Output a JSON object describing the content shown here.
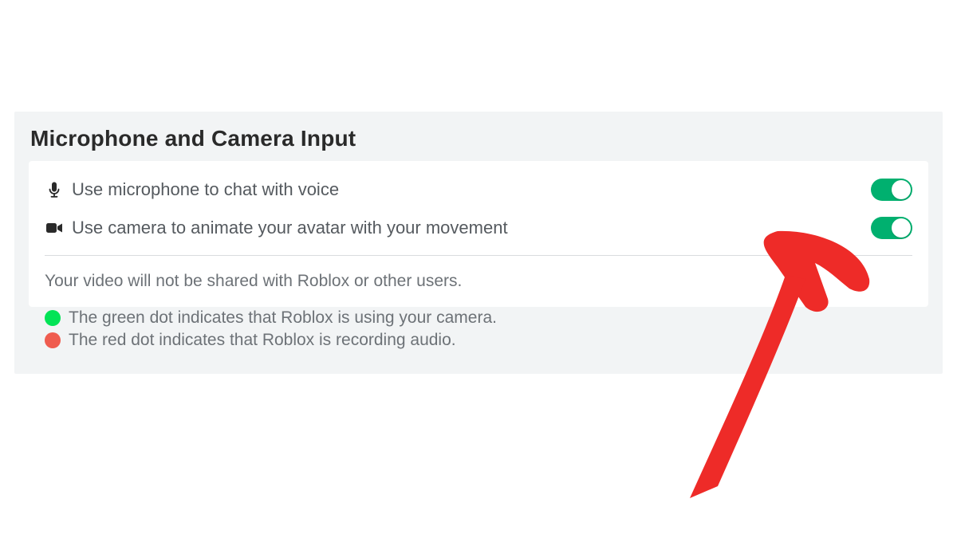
{
  "section": {
    "title": "Microphone and Camera Input"
  },
  "rows": {
    "mic": {
      "label": "Use microphone to chat with voice",
      "toggle_on": true
    },
    "camera": {
      "label": "Use camera to animate your avatar with your movement",
      "toggle_on": true
    }
  },
  "note": {
    "text": "Your video will not be shared with Roblox or other users."
  },
  "legend": {
    "green": "The green dot indicates that Roblox is using your camera.",
    "red": "The red dot indicates that Roblox is recording audio."
  },
  "colors": {
    "toggle_on": "#00b06f",
    "dot_green": "#02e356",
    "dot_red": "#ef5c4f",
    "annotation_red": "#ee2b28"
  }
}
